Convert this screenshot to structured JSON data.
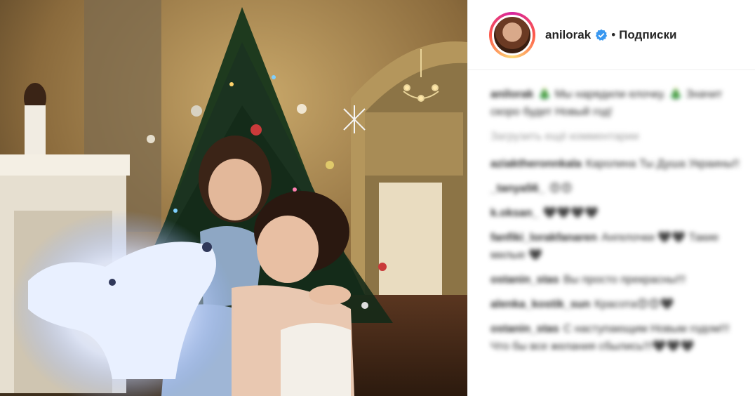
{
  "header": {
    "username": "anilorak",
    "separator": "•",
    "follow_label": "Подписки",
    "verified_color": "#3897f0"
  },
  "post": {
    "author": "anilorak",
    "caption": "🎄 Мы нарядили елочку. 🎄 Значит скоро будет Новый год!",
    "load_more": "Загрузить ещё комментарии"
  },
  "comments": [
    {
      "user": "aziaktheronnkala",
      "text": "Каролина Ты Душа Украины!!"
    },
    {
      "user": "_tanya56_",
      "text": "😍😍"
    },
    {
      "user": "k.oksan_",
      "text": "🖤🖤🖤🖤"
    },
    {
      "user": "fanfiki_lorakfanaren",
      "text": "Ангелочки 🖤🖤 Такие милые 🖤"
    },
    {
      "user": "ostanin_stas",
      "text": "Вы просто прекрасны!!!"
    },
    {
      "user": "alenka_kostik_sun",
      "text": "Красота😍😍🖤"
    },
    {
      "user": "ostanin_stas",
      "text": "С наступающим Новым годом!!! Что бы все желания сбылись!!!🖤🖤🖤"
    }
  ],
  "colors": {
    "text": "#262626",
    "muted": "#999999",
    "border": "#efefef"
  }
}
